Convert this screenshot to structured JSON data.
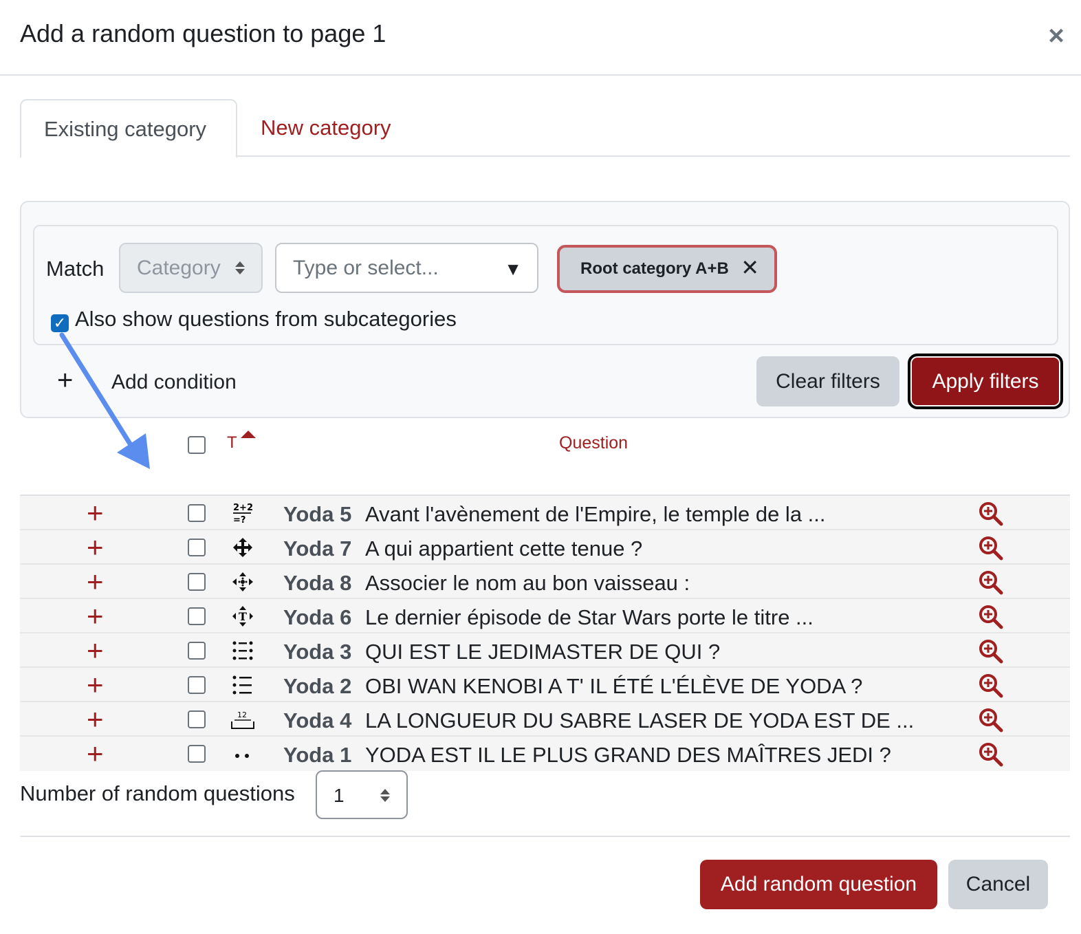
{
  "modal": {
    "title": "Add a random question to page 1",
    "close_icon": "close-icon"
  },
  "tabs": [
    {
      "label": "Existing category",
      "active": true
    },
    {
      "label": "New category",
      "active": false
    }
  ],
  "filter": {
    "match_label": "Match",
    "condition_select": {
      "selected": "Category"
    },
    "value_input": {
      "placeholder": "Type or select..."
    },
    "selected_chip": "Root category A+B",
    "subcategories_label": "Also show questions from subcategories",
    "subcategories_checked": true,
    "add_condition_label": "Add condition",
    "clear_label": "Clear filters",
    "apply_label": "Apply filters"
  },
  "table": {
    "sort_column": "T",
    "question_column": "Question",
    "rows": [
      {
        "name": "Yoda 5",
        "text": "Avant l'avènement de l'Empire, le temple de la ...",
        "icon": "calculated-icon"
      },
      {
        "name": "Yoda 7",
        "text": "A qui appartient cette tenue ?",
        "icon": "drag-drop-image-icon"
      },
      {
        "name": "Yoda 8",
        "text": "Associer le nom au bon vaisseau :",
        "icon": "drag-drop-marker-icon"
      },
      {
        "name": "Yoda 6",
        "text": "Le dernier épisode de Star Wars porte le titre ...",
        "icon": "drag-drop-text-icon"
      },
      {
        "name": "Yoda 3",
        "text": "QUI EST LE JEDIMASTER DE QUI ?",
        "icon": "matching-icon"
      },
      {
        "name": "Yoda 2",
        "text": "OBI WAN KENOBI A T' IL ÉTÉ L'ÉLÈVE DE YODA ?",
        "icon": "multichoice-icon"
      },
      {
        "name": "Yoda 4",
        "text": "LA LONGUEUR DU SABRE LASER DE YODA EST DE ...",
        "icon": "numerical-icon"
      },
      {
        "name": "Yoda 1",
        "text": "YODA EST IL LE PLUS GRAND DES MAÎTRES JEDI ?",
        "icon": "truefalse-icon"
      }
    ]
  },
  "random_count": {
    "label": "Number of random questions",
    "value": "1"
  },
  "footer": {
    "add_label": "Add random question",
    "cancel_label": "Cancel"
  },
  "colors": {
    "accent": "#a01f21",
    "apply_bg": "#8f1519",
    "annotation_arrow": "#5b8def"
  }
}
